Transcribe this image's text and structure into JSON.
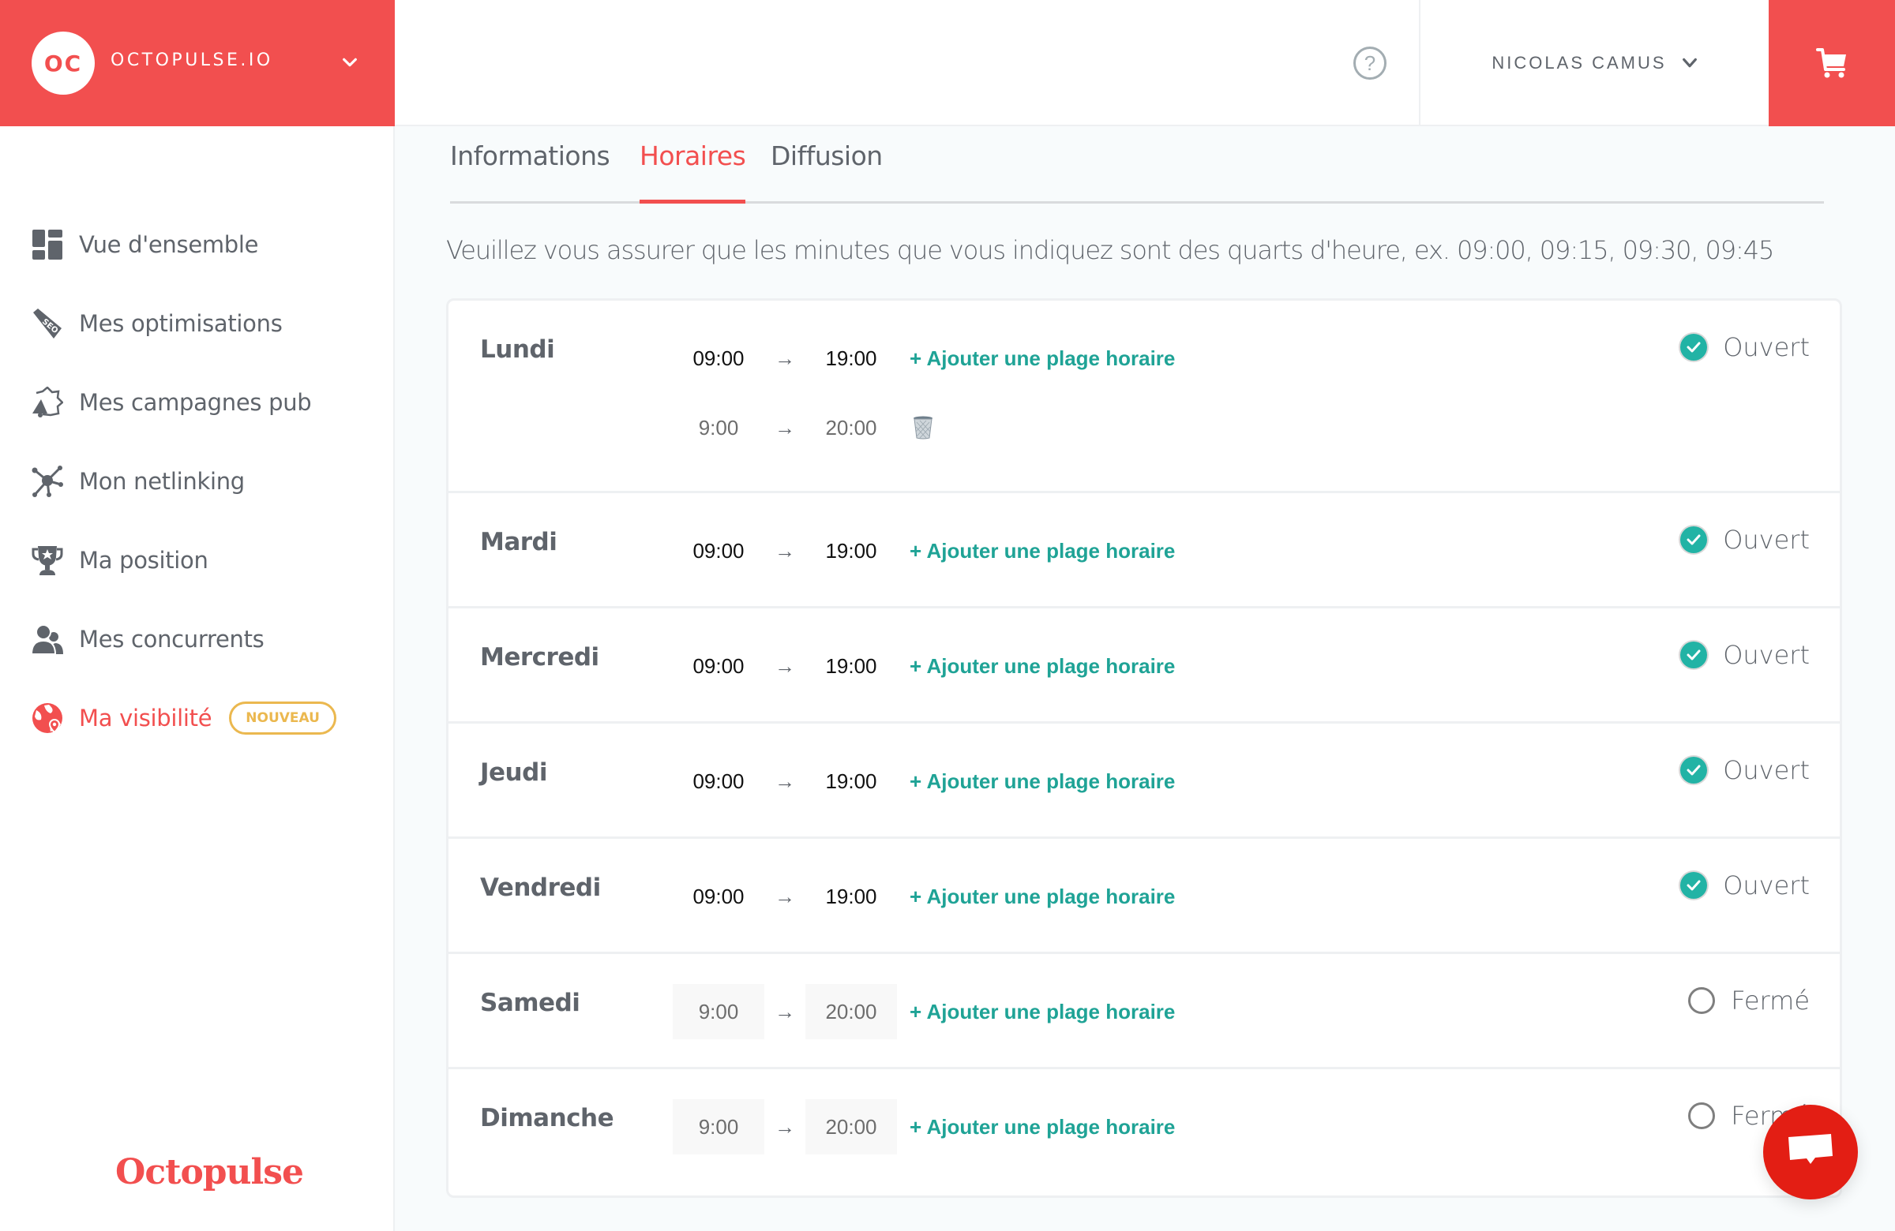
{
  "brand": {
    "initials": "OC",
    "name": "OCTOPULSE.IO",
    "color": "#f24f4f"
  },
  "header": {
    "help_label": "?",
    "user_name": "NICOLAS CAMUS"
  },
  "sidebar": {
    "items": [
      {
        "label": "Vue d'ensemble",
        "icon": "dashboard-icon"
      },
      {
        "label": "Mes optimisations",
        "icon": "seo-tag-icon"
      },
      {
        "label": "Mes campagnes pub",
        "icon": "megaphone-icon"
      },
      {
        "label": "Mon netlinking",
        "icon": "network-icon"
      },
      {
        "label": "Ma position",
        "icon": "trophy-icon"
      },
      {
        "label": "Mes concurrents",
        "icon": "users-icon"
      },
      {
        "label": "Ma visibilité",
        "icon": "globe-pin-icon",
        "active": true,
        "badge": "NOUVEAU"
      }
    ],
    "footer_logo": "Octopulse"
  },
  "tabs": [
    {
      "label": "Informations"
    },
    {
      "label": "Horaires",
      "active": true
    },
    {
      "label": "Diffusion"
    }
  ],
  "notice": "Veuillez vous assurer que les minutes que vous indiquez sont des quarts d'heure, ex. 09:00, 09:15, 09:30, 09:45",
  "add_slot_label": "+ Ajouter une plage horaire",
  "arrow": "→",
  "days": [
    {
      "name": "Lundi",
      "status": "Ouvert",
      "open": true,
      "slots": [
        {
          "start": "09:00",
          "end": "19:00"
        },
        {
          "start": "9:00",
          "end": "20:00"
        }
      ]
    },
    {
      "name": "Mardi",
      "status": "Ouvert",
      "open": true,
      "slots": [
        {
          "start": "09:00",
          "end": "19:00"
        }
      ]
    },
    {
      "name": "Mercredi",
      "status": "Ouvert",
      "open": true,
      "slots": [
        {
          "start": "09:00",
          "end": "19:00"
        }
      ]
    },
    {
      "name": "Jeudi",
      "status": "Ouvert",
      "open": true,
      "slots": [
        {
          "start": "09:00",
          "end": "19:00"
        }
      ]
    },
    {
      "name": "Vendredi",
      "status": "Ouvert",
      "open": true,
      "slots": [
        {
          "start": "09:00",
          "end": "19:00"
        }
      ]
    },
    {
      "name": "Samedi",
      "status": "Fermé",
      "open": false,
      "slots": [
        {
          "start": "9:00",
          "end": "20:00"
        }
      ]
    },
    {
      "name": "Dimanche",
      "status": "Fermé",
      "open": false,
      "slots": [
        {
          "start": "9:00",
          "end": "20:00"
        }
      ]
    }
  ],
  "colors": {
    "accent": "#f24f4f",
    "teal": "#1fa396",
    "check": "#22b3a5",
    "badge": "#ebb84f",
    "chat": "#e31e14"
  }
}
